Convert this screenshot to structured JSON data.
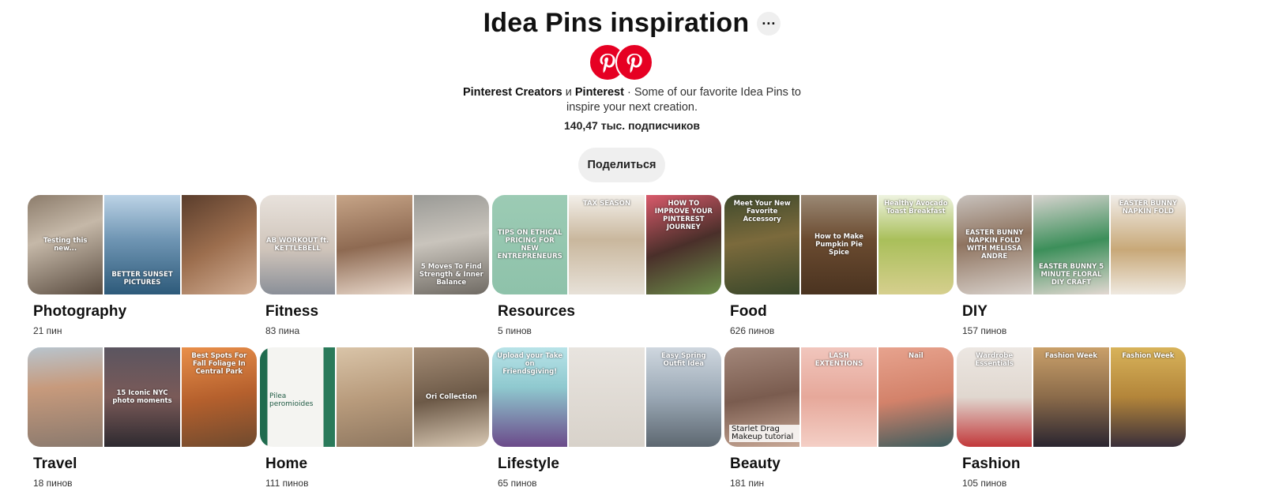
{
  "header": {
    "title": "Idea Pins inspiration",
    "more_icon": "more-dots-icon",
    "owner1": "Pinterest Creators",
    "conj": "и",
    "owner2": "Pinterest",
    "desc_tail": " · Some of our favorite Idea Pins to",
    "desc_line2": "inspire your next creation.",
    "followers": "140,47 тыс. подписчиков",
    "share": "Поделиться",
    "avatar_icon": "pinterest-logo-icon",
    "brand_color": "#e60023"
  },
  "boards": [
    {
      "name": "Photography",
      "count": "21 пин",
      "tiles": [
        {
          "bg": "linear-gradient(160deg,#8c7c6b,#c5b8a8 40%,#5a4c40)",
          "cap": "Testing this new...",
          "cap_pos": "mid"
        },
        {
          "bg": "linear-gradient(180deg,#bcd3e6,#6f95b3 45%,#2d5a7a)",
          "cap": "BETTER SUNSET PICTURES",
          "cap_pos": "bottom"
        },
        {
          "bg": "linear-gradient(150deg,#5a3d2c,#9c6e4e 50%,#d3b096)",
          "cap": "",
          "cap_pos": "none"
        }
      ]
    },
    {
      "name": "Fitness",
      "count": "83 пина",
      "tiles": [
        {
          "bg": "linear-gradient(180deg,#e8e2dc,#cfc4ba 55%,#8a8f98)",
          "cap": "AB WORKOUT ft. KETTLEBELL",
          "cap_pos": "mid"
        },
        {
          "bg": "linear-gradient(170deg,#c6a487,#8e6a52 50%,#e9d9cc)",
          "cap": "",
          "cap_pos": "none"
        },
        {
          "bg": "linear-gradient(170deg,#9a9a96,#c9c4bc 45%,#6f6a63)",
          "cap": "5 Moves To Find Strength & Inner Balance",
          "cap_pos": "bottom"
        }
      ]
    },
    {
      "name": "Resources",
      "count": "5 пинов",
      "tiles": [
        {
          "bg": "linear-gradient(180deg,#9ccbb4,#8ec2aa)",
          "cap": "TIPS ON ETHICAL PRICING FOR NEW ENTREPRENEURS",
          "cap_pos": "mid"
        },
        {
          "bg": "linear-gradient(180deg,#f3f0ea,#c9b79d 45%,#e7e1d8)",
          "cap": "TAX SEASON",
          "cap_pos": "top"
        },
        {
          "bg": "linear-gradient(160deg,#d95a6b,#4a2f2a 50%,#6c8f4a)",
          "cap": "HOW TO IMPROVE YOUR PINTEREST JOURNEY",
          "cap_pos": "top"
        }
      ]
    },
    {
      "name": "Food",
      "count": "626 пинов",
      "tiles": [
        {
          "bg": "linear-gradient(170deg,#3f4a2c,#7b6a3c 45%,#39472a)",
          "cap": "Meet Your New Favorite Accessory",
          "cap_pos": "top"
        },
        {
          "bg": "linear-gradient(180deg,#9a8874,#6b4b30 45%,#4a3320)",
          "cap": "How to Make Pumpkin Pie Spice",
          "cap_pos": "mid"
        },
        {
          "bg": "linear-gradient(180deg,#eef3e0,#a9bf5a 45%,#d6cf8e)",
          "cap": "Healthy Avocado Toast Breakfast",
          "cap_pos": "top"
        }
      ]
    },
    {
      "name": "DIY",
      "count": "157 пинов",
      "tiles": [
        {
          "bg": "linear-gradient(170deg,#c8c2bd,#8f7460 45%,#d8d1cb)",
          "cap": "EASTER BUNNY NAPKIN FOLD WITH MELISSA ANDRE",
          "cap_pos": "mid"
        },
        {
          "bg": "linear-gradient(170deg,#d7d3cf,#3c8f5a 50%,#e3d8d2)",
          "cap": "EASTER BUNNY 5 MINUTE FLORAL DIY CRAFT",
          "cap_pos": "bottom"
        },
        {
          "bg": "linear-gradient(180deg,#f1eee9,#c8a878 55%,#efe9e0)",
          "cap": "EASTER BUNNY NAPKIN FOLD",
          "cap_pos": "top"
        }
      ]
    },
    {
      "name": "Travel",
      "count": "18 пинов",
      "tiles": [
        {
          "bg": "linear-gradient(175deg,#b8c4cd,#c79a7c 40%,#8b7a6e)",
          "cap": "",
          "cap_pos": "none"
        },
        {
          "bg": "linear-gradient(180deg,#5b5560,#7a5a58 50%,#2e2a30)",
          "cap": "15 Iconic NYC photo moments",
          "cap_pos": "mid"
        },
        {
          "bg": "linear-gradient(170deg,#e98f4a,#b5602d 50%,#6f4a2e)",
          "cap": "Best Spots For Fall Foliage In Central Park",
          "cap_pos": "top"
        }
      ]
    },
    {
      "name": "Home",
      "count": "111 пинов",
      "tiles": [
        {
          "bg": "linear-gradient(90deg,#1f6b4e 0%,#1f6b4e 10%,#f4f4f1 10%,#f4f4f1 85%,#2a7a5a 85%)",
          "cap": "Pilea peromioides",
          "cap_pos": "mid-left"
        },
        {
          "bg": "linear-gradient(170deg,#d9c4a8,#b89b7c 50%,#8e7760)",
          "cap": "",
          "cap_pos": "none"
        },
        {
          "bg": "linear-gradient(170deg,#a38b74,#6d5a48 50%,#d9c9b4)",
          "cap": "Ori Collection",
          "cap_pos": "mid"
        }
      ]
    },
    {
      "name": "Lifestyle",
      "count": "65 пинов",
      "tiles": [
        {
          "bg": "linear-gradient(180deg,#b8e3e8,#8fc9cf 40%,#6b4a8a)",
          "cap": "Upload your Take on Friendsgiving!",
          "cap_pos": "top"
        },
        {
          "bg": "linear-gradient(180deg,#e8e4df,#d8d2ca)",
          "cap": "",
          "cap_pos": "none"
        },
        {
          "bg": "linear-gradient(180deg,#cfd7df,#9aa8b5 50%,#5d6770)",
          "cap": "Easy Spring Outfit Idea",
          "cap_pos": "top"
        }
      ]
    },
    {
      "name": "Beauty",
      "count": "181 пин",
      "tiles": [
        {
          "bg": "linear-gradient(170deg,#a3877a,#7a5c4f 50%,#c8a896)",
          "cap": "Starlet Drag Makeup tutorial",
          "cap_pos": "bottom-left"
        },
        {
          "bg": "linear-gradient(180deg,#f1c6bd,#e6a89a 50%,#f4cfc6)",
          "cap": "LASH EXTENTIONS",
          "cap_pos": "top"
        },
        {
          "bg": "linear-gradient(170deg,#e7a38e,#d3826a 50%,#3a5c5e)",
          "cap": "Nail",
          "cap_pos": "top"
        }
      ]
    },
    {
      "name": "Fashion",
      "count": "105 пинов",
      "tiles": [
        {
          "bg": "linear-gradient(180deg,#ece7e2,#e0d7cf 50%,#c2383a)",
          "cap": "Wardrobe Essentials",
          "cap_pos": "top"
        },
        {
          "bg": "linear-gradient(180deg,#caa06a,#8b6b4a 50%,#2a2530)",
          "cap": "Fashion Week",
          "cap_pos": "top"
        },
        {
          "bg": "linear-gradient(180deg,#d8b35a,#b3853a 50%,#3a2f3a)",
          "cap": "Fashion Week",
          "cap_pos": "top"
        }
      ]
    }
  ]
}
